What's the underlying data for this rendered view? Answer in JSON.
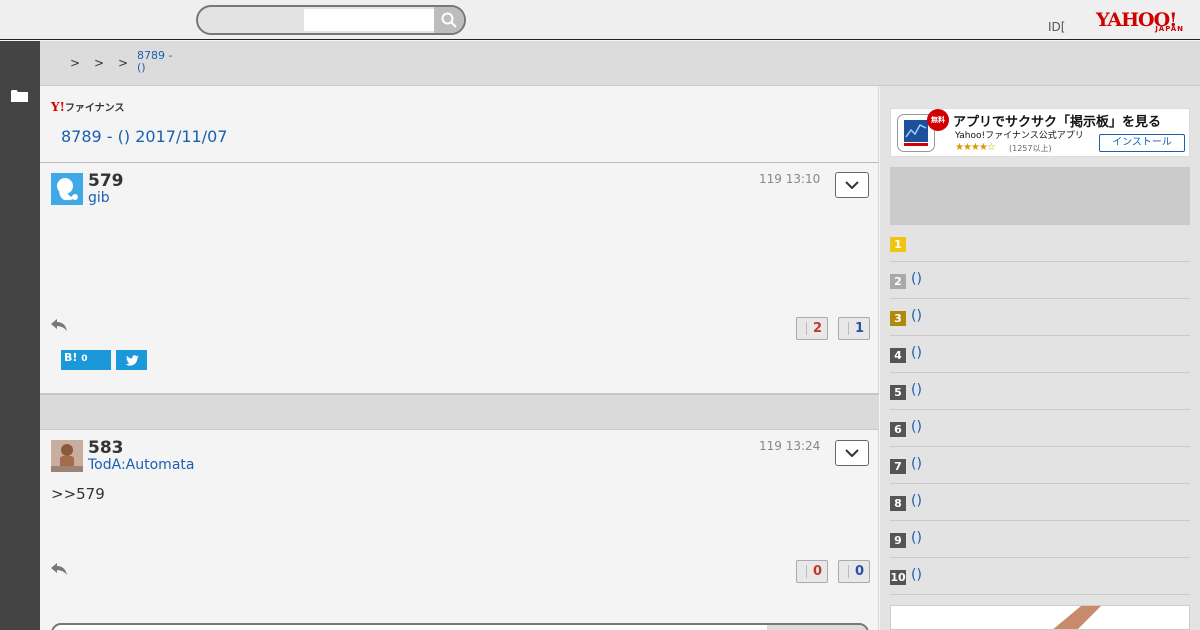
{
  "header": {
    "search": {
      "value": "",
      "placeholder": ""
    },
    "id_text": "ID[",
    "logo_word": "YAHOO!",
    "logo_sub": "JAPAN"
  },
  "nav": {
    "folder_icon": "folder-icon"
  },
  "breadcrumb": {
    "separators": [
      ">",
      ">",
      ">"
    ],
    "current": "8789 -\n()"
  },
  "main": {
    "fin_logo_y": "Y!",
    "fin_logo_text": "ファイナンス",
    "thread_title": "8789 -  () 2017/11/07",
    "posts": [
      {
        "number": "579",
        "user": "gib",
        "time": "119 13:10",
        "body": "",
        "votes_up": "2",
        "votes_down": "1",
        "hatena_label": "B!",
        "hatena_count": "0"
      },
      {
        "number": "583",
        "user": "TodA:Automata",
        "time": "119 13:24",
        "body": ">>579",
        "votes_up": "0",
        "votes_down": "0"
      }
    ]
  },
  "right": {
    "app_ad": {
      "badge": "無料",
      "title": "アプリでサクサク「掲示板」を見る",
      "subtitle": "Yahoo!ファイナンス公式アプリ",
      "stars": "★★★★☆",
      "rating": "(1257以上)",
      "install": "インストール"
    },
    "ranking": [
      {
        "num": "1",
        "label": "",
        "color": "#f1c40f"
      },
      {
        "num": "2",
        "label": "()",
        "color": "#a9a9a9"
      },
      {
        "num": "3",
        "label": "()",
        "color": "#b08a10"
      },
      {
        "num": "4",
        "label": "()",
        "color": "#555555"
      },
      {
        "num": "5",
        "label": "()",
        "color": "#555555"
      },
      {
        "num": "6",
        "label": "()",
        "color": "#555555"
      },
      {
        "num": "7",
        "label": "()",
        "color": "#555555"
      },
      {
        "num": "8",
        "label": "()",
        "color": "#555555"
      },
      {
        "num": "9",
        "label": "()",
        "color": "#555555"
      },
      {
        "num": "10",
        "label": "()",
        "color": "#555555"
      }
    ]
  },
  "colors": {
    "link": "#1b5fb0",
    "brand_red": "#d10000",
    "vote_up": "#c0392b",
    "vote_down": "#2d4ea8",
    "share_blue": "#1a98d8"
  }
}
